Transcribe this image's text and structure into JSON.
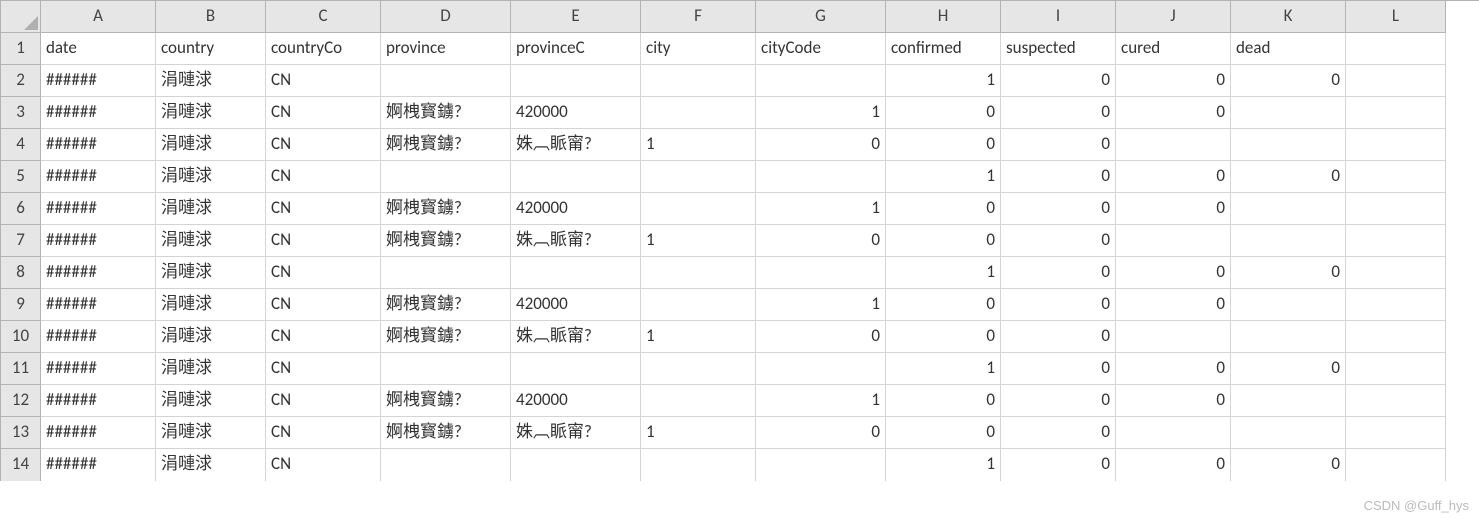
{
  "columns": [
    "A",
    "B",
    "C",
    "D",
    "E",
    "F",
    "G",
    "H",
    "I",
    "J",
    "K",
    "L"
  ],
  "headers": [
    "date",
    "country",
    "countryCo",
    "province",
    "provinceC",
    "city",
    "cityCode",
    "confirmed",
    "suspected",
    "cured",
    "dead",
    ""
  ],
  "numericCols": [
    6,
    7,
    8,
    9,
    10
  ],
  "rows": [
    [
      "######",
      "涓嗹浗",
      "CN",
      "",
      "",
      "",
      "",
      "1",
      "0",
      "0",
      "0",
      ""
    ],
    [
      "######",
      "涓嗹浗",
      "CN",
      "婀栧寳鐪?",
      "420000",
      "",
      "1",
      "0",
      "0",
      "0",
      "",
      ""
    ],
    [
      "######",
      "涓嗹浗",
      "CN",
      "婀栧寳鐪?",
      "姝︹眽甯?",
      "1",
      "0",
      "0",
      "0",
      "",
      "",
      ""
    ],
    [
      "######",
      "涓嗹浗",
      "CN",
      "",
      "",
      "",
      "",
      "1",
      "0",
      "0",
      "0",
      ""
    ],
    [
      "######",
      "涓嗹浗",
      "CN",
      "婀栧寳鐪?",
      "420000",
      "",
      "1",
      "0",
      "0",
      "0",
      "",
      ""
    ],
    [
      "######",
      "涓嗹浗",
      "CN",
      "婀栧寳鐪?",
      "姝︹眽甯?",
      "1",
      "0",
      "0",
      "0",
      "",
      "",
      ""
    ],
    [
      "######",
      "涓嗹浗",
      "CN",
      "",
      "",
      "",
      "",
      "1",
      "0",
      "0",
      "0",
      ""
    ],
    [
      "######",
      "涓嗹浗",
      "CN",
      "婀栧寳鐪?",
      "420000",
      "",
      "1",
      "0",
      "0",
      "0",
      "",
      ""
    ],
    [
      "######",
      "涓嗹浗",
      "CN",
      "婀栧寳鐪?",
      "姝︹眽甯?",
      "1",
      "0",
      "0",
      "0",
      "",
      "",
      ""
    ],
    [
      "######",
      "涓嗹浗",
      "CN",
      "",
      "",
      "",
      "",
      "1",
      "0",
      "0",
      "0",
      ""
    ],
    [
      "######",
      "涓嗹浗",
      "CN",
      "婀栧寳鐪?",
      "420000",
      "",
      "1",
      "0",
      "0",
      "0",
      "",
      ""
    ],
    [
      "######",
      "涓嗹浗",
      "CN",
      "婀栧寳鐪?",
      "姝︹眽甯?",
      "1",
      "0",
      "0",
      "0",
      "",
      "",
      ""
    ],
    [
      "######",
      "涓嗹浗",
      "CN",
      "",
      "",
      "",
      "",
      "1",
      "0",
      "0",
      "0",
      ""
    ]
  ],
  "watermark": "CSDN @Guff_hys"
}
